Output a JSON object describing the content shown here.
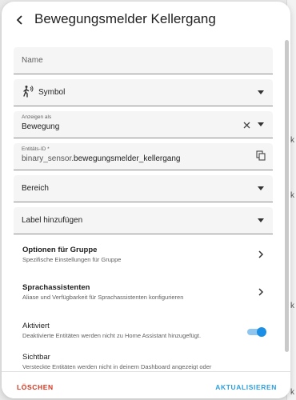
{
  "dialog": {
    "title": "Bewegungsmelder Kellergang",
    "back_icon": "arrow-left-icon"
  },
  "fields": {
    "name": {
      "placeholder": "Name"
    },
    "symbol": {
      "label": "Symbol",
      "icon": "motion-sensor-icon"
    },
    "show_as": {
      "label": "Anzeigen als",
      "value": "Bewegung"
    },
    "entity_id": {
      "label": "Entitäts-ID *",
      "value_prefix": "binary_sensor.",
      "value_suffix": "bewegungsmelder_kellergang",
      "copy_icon": "copy-icon"
    },
    "area": {
      "label": "Bereich"
    },
    "labels": {
      "label": "Label hinzufügen"
    }
  },
  "rows": {
    "group_options": {
      "title": "Optionen für Gruppe",
      "subtitle": "Spezifische Einstellungen für Gruppe"
    },
    "voice_assistants": {
      "title": "Sprachassistenten",
      "subtitle": "Aliase und Verfügbarkeit für Sprachassistenten konfigurieren"
    },
    "enabled": {
      "title": "Aktiviert",
      "subtitle": "Deaktivierte Entitäten werden nicht zu Home Assistant hinzugefügt.",
      "checked": true
    },
    "visible": {
      "title": "Sichtbar",
      "subtitle": "Versteckte Entitäten werden nicht in deinem Dashboard angezeigt oder",
      "checked": true
    }
  },
  "footer": {
    "delete_label": "LÖSCHEN",
    "update_label": "AKTUALISIEREN"
  },
  "colors": {
    "accent": "#1b8ee6",
    "delete": "#d8341c",
    "update": "#2ba0e0"
  }
}
